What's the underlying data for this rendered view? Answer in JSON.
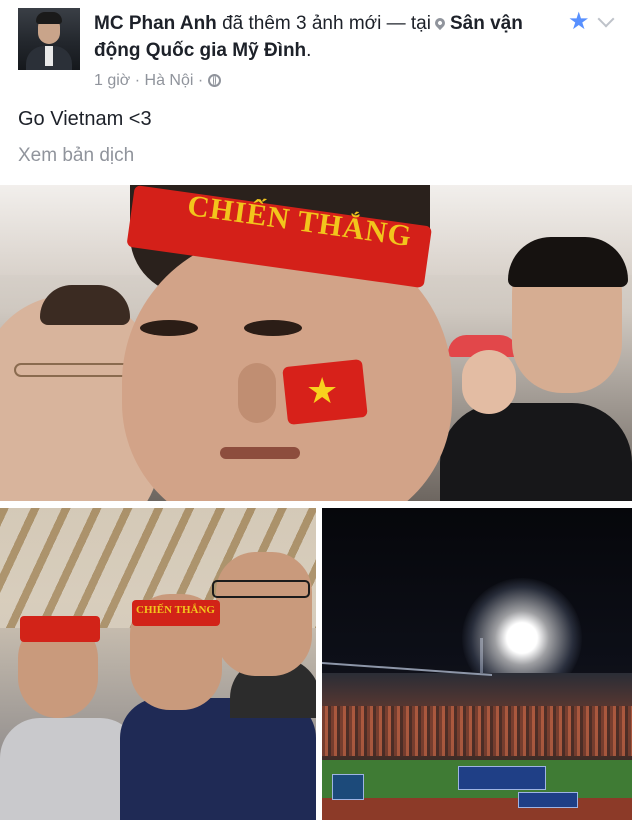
{
  "post": {
    "author": "MC Phan Anh",
    "action": "đã thêm 3 ảnh mới — tại",
    "location": "Sân vận động Quốc gia Mỹ Đình",
    "period": ".",
    "time": "1 giờ",
    "separator": "·",
    "place": "Hà Nội",
    "privacy_icon": "globe-icon",
    "text": "Go Vietnam <3",
    "translate_link": "Xem bản dịch"
  },
  "icons": {
    "star": "star-icon",
    "chevron": "chevron-down-icon",
    "pin": "location-pin-icon"
  },
  "colors": {
    "link": "#1d2129",
    "meta": "#90949c",
    "star": "#5890ff"
  },
  "photos": {
    "headband_text": "CHIẾN THẮNG",
    "headband_text_small": "CHIẾN THẮNG"
  }
}
